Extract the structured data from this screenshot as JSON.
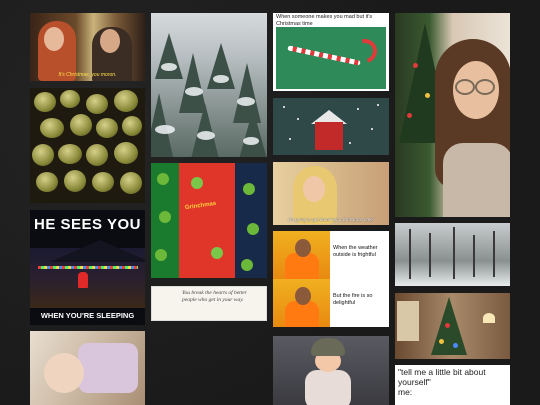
{
  "gallery": {
    "tiles": [
      {
        "id": "christmas-movie",
        "caption": "It's Christmas, you moron."
      },
      {
        "id": "brussels-sprouts",
        "caption": ""
      },
      {
        "id": "he-sees-you",
        "caption_top": "HE SEES YOU",
        "caption_bottom": "WHEN YOU'RE SLEEPING"
      },
      {
        "id": "baby-photo",
        "caption": ""
      },
      {
        "id": "snowy-trees",
        "caption": ""
      },
      {
        "id": "grinch-pajamas",
        "caption": "Grinchmas"
      },
      {
        "id": "poem-card",
        "caption": "You break the hearts of better people who get in your way."
      },
      {
        "id": "candy-cane",
        "caption": "When someone makes you mad but it's Christmas time"
      },
      {
        "id": "snoopy-doghouse",
        "caption": ""
      },
      {
        "id": "blonde-woman",
        "caption": "I'm going to get drunk for a Christmas time!"
      },
      {
        "id": "drake-1",
        "caption": "When the weather outside is frightful"
      },
      {
        "id": "drake-2",
        "caption": "But the fire is so delightful"
      },
      {
        "id": "swaddled-baby",
        "caption": ""
      },
      {
        "id": "woman-glasses",
        "caption": ""
      },
      {
        "id": "snowy-forest",
        "caption": ""
      },
      {
        "id": "living-room-tree",
        "caption": ""
      },
      {
        "id": "tell-me-meme",
        "caption": "\"tell me a little bit about yourself\"\nme:"
      }
    ]
  },
  "colors": {
    "background": "#1b1b1b",
    "grinch_red": "#e0362a",
    "grinch_green": "#1a7a2e",
    "drake_orange": "#ff7a10"
  }
}
